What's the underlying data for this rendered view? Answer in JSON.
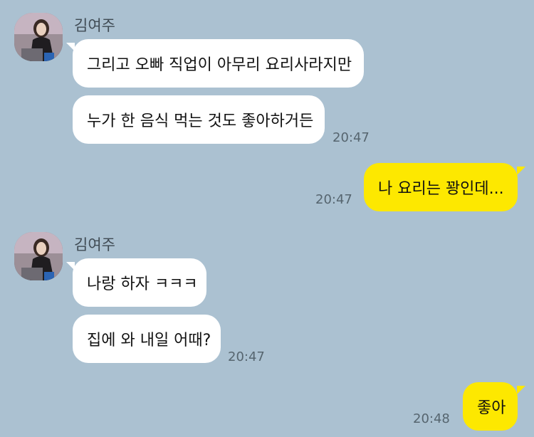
{
  "conversation": [
    {
      "sender": "김여주",
      "avatar_icon": "profile-photo-avatar",
      "messages": [
        "그리고 오빠 직업이 아무리 요리사라지만",
        "누가 한 음식 먹는 것도 좋아하거든"
      ],
      "time": "20:47"
    },
    {
      "me": true,
      "messages": [
        "나 요리는 꽝인데..."
      ],
      "time": "20:47"
    },
    {
      "sender": "김여주",
      "avatar_icon": "profile-photo-avatar",
      "messages": [
        "나랑 하자 ㅋㅋㅋ",
        "집에 와 내일 어때?"
      ],
      "time": "20:47"
    },
    {
      "me": true,
      "messages": [
        "좋아"
      ],
      "time": "20:48"
    }
  ],
  "colors": {
    "background": "#abc1d1",
    "incoming_bubble": "#ffffff",
    "outgoing_bubble": "#fde800"
  }
}
